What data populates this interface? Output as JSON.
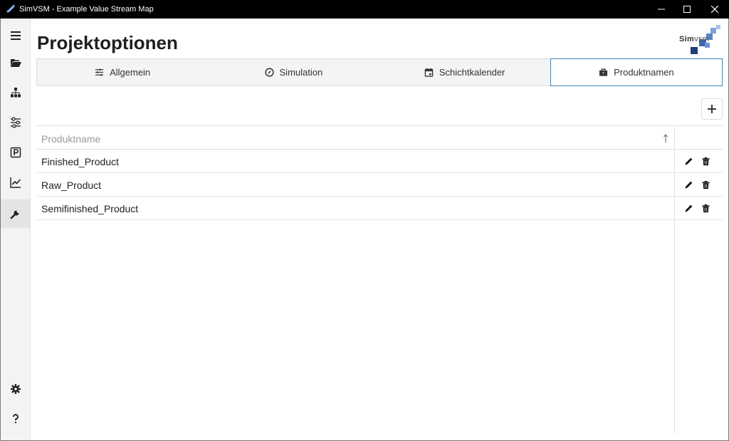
{
  "window": {
    "title": "SimVSM - Example Value Stream Map",
    "controls": [
      "minimize-icon",
      "maximize-icon",
      "close-icon"
    ]
  },
  "sidebar": {
    "items": [
      {
        "icon": "menu-icon"
      },
      {
        "icon": "folder-open-icon"
      },
      {
        "icon": "sitemap-icon"
      },
      {
        "icon": "sliders-icon"
      },
      {
        "icon": "parking-icon"
      },
      {
        "icon": "chart-line-icon"
      },
      {
        "icon": "wrench-icon",
        "active": true
      }
    ],
    "bottom_items": [
      {
        "icon": "gear-icon"
      },
      {
        "icon": "question-icon"
      }
    ]
  },
  "page": {
    "title": "Projektoptionen"
  },
  "logo": {
    "text_bold": "Sim",
    "text_light": "VSM"
  },
  "tabs": [
    {
      "label": "Allgemein",
      "icon": "sliders-icon",
      "active": false
    },
    {
      "label": "Simulation",
      "icon": "compass-icon",
      "active": false
    },
    {
      "label": "Schichtkalender",
      "icon": "calendar-icon",
      "active": false
    },
    {
      "label": "Produktnamen",
      "icon": "briefcase-icon",
      "active": true
    }
  ],
  "table": {
    "header": "Produktname",
    "sort": "ascending",
    "rows": [
      {
        "name": "Finished_Product"
      },
      {
        "name": "Raw_Product"
      },
      {
        "name": "Semifinished_Product"
      }
    ]
  },
  "colors": {
    "accent": "#3f86b8",
    "titlebar": "#000000",
    "logo_blue": "#5b86c7"
  }
}
